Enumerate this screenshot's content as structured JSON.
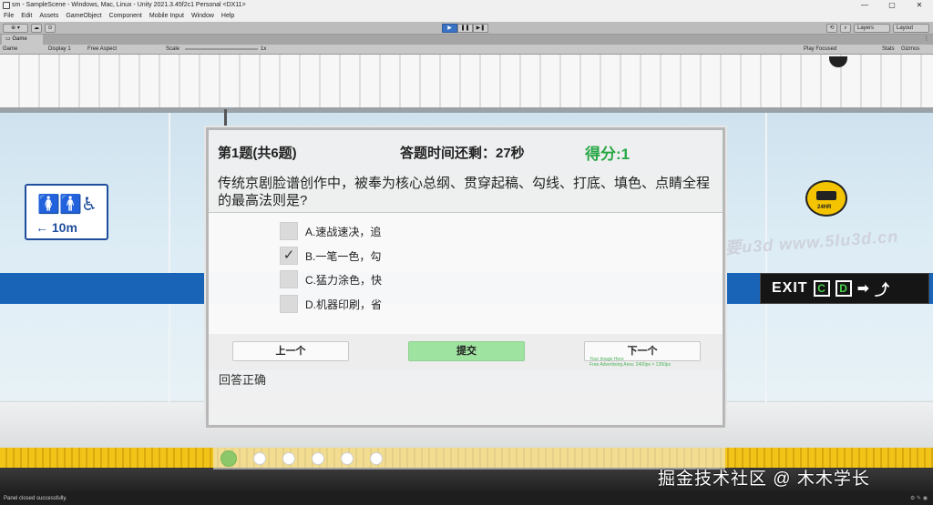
{
  "window": {
    "title": "sm - SampleScene - Windows, Mac, Linux - Unity 2021.3.45f2c1 Personal <DX11>",
    "controls": [
      "—",
      "▢",
      "✕"
    ]
  },
  "menu": [
    "File",
    "Edit",
    "Assets",
    "GameObject",
    "Component",
    "Mobile Input",
    "Window",
    "Help"
  ],
  "toolbar": {
    "account": "⊕ ▾",
    "play_icons": [
      "▶",
      "❚❚",
      "▶❚"
    ],
    "layers": "Layers",
    "layout": "Layout"
  },
  "game_view": {
    "tab": "Game",
    "display_mode": "Game",
    "display": "Display 1",
    "aspect": "Free Aspect",
    "scale_label": "Scale",
    "scale_value": "1x",
    "play_focused": "Play Focused",
    "stats": "Stats",
    "gizmos": "Gizmos"
  },
  "scene": {
    "wc_distance": "← 10m",
    "cam_label": "24HR",
    "exit_text": "EXIT",
    "exit_boxes": [
      "C",
      "D"
    ],
    "exit_arrow": "➡",
    "watermark": "我要u3d www.5lu3d.cn"
  },
  "quiz": {
    "question_number": "第1题(共6题)",
    "timer": "答题时间还剩：27秒",
    "score": "得分:1",
    "question": "传统京剧脸谱创作中，被奉为核心总纲、贯穿起稿、勾线、打底、填色、点睛全程的最高法则是?",
    "options": [
      {
        "label": "A.速战速决，追",
        "checked": false,
        "mark": ""
      },
      {
        "label": "B.一笔一色，勾",
        "checked": true,
        "mark": "✓"
      },
      {
        "label": "C.猛力涂色，快",
        "checked": false,
        "mark": ""
      },
      {
        "label": "D.机器印刷，省",
        "checked": false,
        "mark": ""
      }
    ],
    "prev_label": "上一个",
    "submit_label": "提交",
    "next_label": "下一个",
    "advert_line1": "Your Image Here",
    "advert_line2": "Free Advertising Area: 2400px × 1350px",
    "result": "回答正确",
    "total_pages": 6,
    "current_page": 1
  },
  "corner_watermark": "掘金技术社区 @ 木木学长",
  "status": "Panel closed successfully.",
  "colors": {
    "score_green": "#27a745",
    "submit_green": "#9fe3a0",
    "current_dot": "#8cc86a",
    "platform_blue": "#1a64b8"
  }
}
